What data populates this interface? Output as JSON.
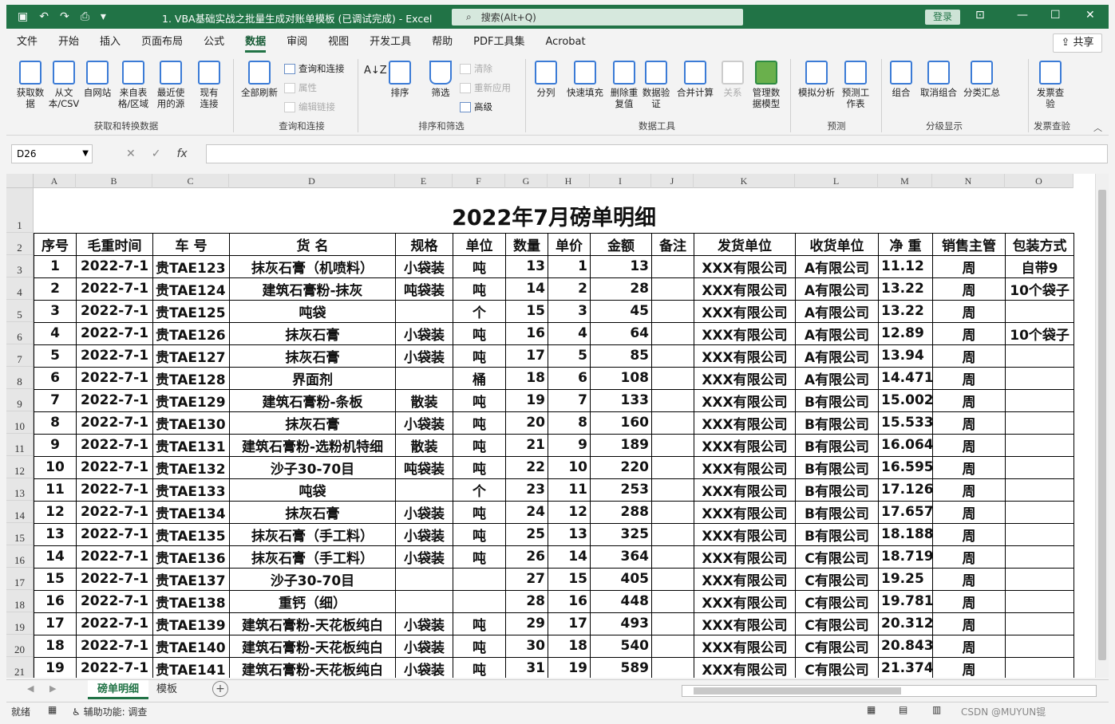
{
  "title_bar": {
    "doc_title": "1. VBA基础实战之批量生成对账单模板 (已调试完成)  -  Excel",
    "search_placeholder": "搜索(Alt+Q)",
    "login": "登录"
  },
  "menu": {
    "tabs": [
      "文件",
      "开始",
      "插入",
      "页面布局",
      "公式",
      "数据",
      "审阅",
      "视图",
      "开发工具",
      "帮助",
      "PDF工具集",
      "Acrobat"
    ],
    "active_index": 5,
    "share": "共享"
  },
  "ribbon": {
    "get_from_data": "获取数据",
    "from_text": "从文本/CSV",
    "from_web": "自网站",
    "from_table": "来自表格/区域",
    "recent_sources": "最近使用的源",
    "existing_conn": "现有连接",
    "group_get": "获取和转换数据",
    "refresh_all": "全部刷新",
    "queries_conn": "查询和连接",
    "properties": "属性",
    "edit_links": "编辑链接",
    "group_query": "查询和连接",
    "sort": "排序",
    "filter": "筛选",
    "clear": "清除",
    "reapply": "重新应用",
    "advanced": "高级",
    "group_sort": "排序和筛选",
    "text_to_col": "分列",
    "flash_fill": "快速填充",
    "remove_dup": "删除重复值",
    "data_valid": "数据验证",
    "consolidate": "合并计算",
    "relationships": "关系",
    "manage_model": "管理数据模型",
    "group_tools": "数据工具",
    "whatif": "模拟分析",
    "forecast": "预测工作表",
    "group_forecast": "预测",
    "group_btn": "组合",
    "ungroup": "取消组合",
    "subtotal": "分类汇总",
    "group_outline": "分级显示",
    "invoice_check": "发票查验",
    "group_invoice": "发票查验"
  },
  "formula_bar": {
    "name_box": "D26",
    "cancel": "✕",
    "enter": "✓",
    "fx": "fx",
    "value": ""
  },
  "columns": [
    "A",
    "B",
    "C",
    "D",
    "E",
    "F",
    "G",
    "H",
    "I",
    "J",
    "K",
    "L",
    "M",
    "N",
    "O"
  ],
  "sheet": {
    "title": "2022年7月磅单明细",
    "headers": [
      "序号",
      "毛重时间",
      "车 号",
      "货 名",
      "规格",
      "单位",
      "数量",
      "单价",
      "金额",
      "备注",
      "发货单位",
      "收货单位",
      "净 重",
      "销售主管",
      "包装方式"
    ],
    "rows": [
      [
        "1",
        "2022-7-1",
        "贵TAE123",
        "抹灰石膏（机喷料）",
        "小袋装",
        "吨",
        "13",
        "1",
        "13",
        "",
        "XXX有限公司",
        "A有限公司",
        "11.12",
        "周",
        "自带9"
      ],
      [
        "2",
        "2022-7-1",
        "贵TAE124",
        "建筑石膏粉-抹灰",
        "吨袋装",
        "吨",
        "14",
        "2",
        "28",
        "",
        "XXX有限公司",
        "A有限公司",
        "13.22",
        "周",
        "10个袋子"
      ],
      [
        "3",
        "2022-7-1",
        "贵TAE125",
        "吨袋",
        "",
        "个",
        "15",
        "3",
        "45",
        "",
        "XXX有限公司",
        "A有限公司",
        "13.22",
        "周",
        ""
      ],
      [
        "4",
        "2022-7-1",
        "贵TAE126",
        "抹灰石膏",
        "小袋装",
        "吨",
        "16",
        "4",
        "64",
        "",
        "XXX有限公司",
        "A有限公司",
        "12.89",
        "周",
        "10个袋子"
      ],
      [
        "5",
        "2022-7-1",
        "贵TAE127",
        "抹灰石膏",
        "小袋装",
        "吨",
        "17",
        "5",
        "85",
        "",
        "XXX有限公司",
        "A有限公司",
        "13.94",
        "周",
        ""
      ],
      [
        "6",
        "2022-7-1",
        "贵TAE128",
        "界面剂",
        "",
        "桶",
        "18",
        "6",
        "108",
        "",
        "XXX有限公司",
        "A有限公司",
        "14.471",
        "周",
        ""
      ],
      [
        "7",
        "2022-7-1",
        "贵TAE129",
        "建筑石膏粉-条板",
        "散装",
        "吨",
        "19",
        "7",
        "133",
        "",
        "XXX有限公司",
        "B有限公司",
        "15.002",
        "周",
        ""
      ],
      [
        "8",
        "2022-7-1",
        "贵TAE130",
        "抹灰石膏",
        "小袋装",
        "吨",
        "20",
        "8",
        "160",
        "",
        "XXX有限公司",
        "B有限公司",
        "15.533",
        "周",
        ""
      ],
      [
        "9",
        "2022-7-1",
        "贵TAE131",
        "建筑石膏粉-选粉机特细",
        "散装",
        "吨",
        "21",
        "9",
        "189",
        "",
        "XXX有限公司",
        "B有限公司",
        "16.064",
        "周",
        ""
      ],
      [
        "10",
        "2022-7-1",
        "贵TAE132",
        "沙子30-70目",
        "吨袋装",
        "吨",
        "22",
        "10",
        "220",
        "",
        "XXX有限公司",
        "B有限公司",
        "16.595",
        "周",
        ""
      ],
      [
        "11",
        "2022-7-1",
        "贵TAE133",
        "吨袋",
        "",
        "个",
        "23",
        "11",
        "253",
        "",
        "XXX有限公司",
        "B有限公司",
        "17.126",
        "周",
        ""
      ],
      [
        "12",
        "2022-7-1",
        "贵TAE134",
        "抹灰石膏",
        "小袋装",
        "吨",
        "24",
        "12",
        "288",
        "",
        "XXX有限公司",
        "B有限公司",
        "17.657",
        "周",
        ""
      ],
      [
        "13",
        "2022-7-1",
        "贵TAE135",
        "抹灰石膏（手工料）",
        "小袋装",
        "吨",
        "25",
        "13",
        "325",
        "",
        "XXX有限公司",
        "B有限公司",
        "18.188",
        "周",
        ""
      ],
      [
        "14",
        "2022-7-1",
        "贵TAE136",
        "抹灰石膏（手工料）",
        "小袋装",
        "吨",
        "26",
        "14",
        "364",
        "",
        "XXX有限公司",
        "C有限公司",
        "18.719",
        "周",
        ""
      ],
      [
        "15",
        "2022-7-1",
        "贵TAE137",
        "沙子30-70目",
        "",
        "",
        "27",
        "15",
        "405",
        "",
        "XXX有限公司",
        "C有限公司",
        "19.25",
        "周",
        ""
      ],
      [
        "16",
        "2022-7-1",
        "贵TAE138",
        "重钙（细）",
        "",
        "",
        "28",
        "16",
        "448",
        "",
        "XXX有限公司",
        "C有限公司",
        "19.781",
        "周",
        ""
      ],
      [
        "17",
        "2022-7-1",
        "贵TAE139",
        "建筑石膏粉-天花板纯白",
        "小袋装",
        "吨",
        "29",
        "17",
        "493",
        "",
        "XXX有限公司",
        "C有限公司",
        "20.312",
        "周",
        ""
      ],
      [
        "18",
        "2022-7-1",
        "贵TAE140",
        "建筑石膏粉-天花板纯白",
        "小袋装",
        "吨",
        "30",
        "18",
        "540",
        "",
        "XXX有限公司",
        "C有限公司",
        "20.843",
        "周",
        ""
      ],
      [
        "19",
        "2022-7-1",
        "贵TAE141",
        "建筑石膏粉-天花板纯白",
        "小袋装",
        "吨",
        "31",
        "19",
        "589",
        "",
        "XXX有限公司",
        "C有限公司",
        "21.374",
        "周",
        ""
      ]
    ]
  },
  "sheet_tabs": {
    "tabs": [
      "磅单明细",
      "模板"
    ],
    "active": 0,
    "add": "+"
  },
  "status": {
    "ready": "就绪",
    "accessibility": "辅助功能: 调查",
    "watermark": "CSDN @MUYUN锟"
  },
  "colors": {
    "excel_green": "#217346"
  }
}
